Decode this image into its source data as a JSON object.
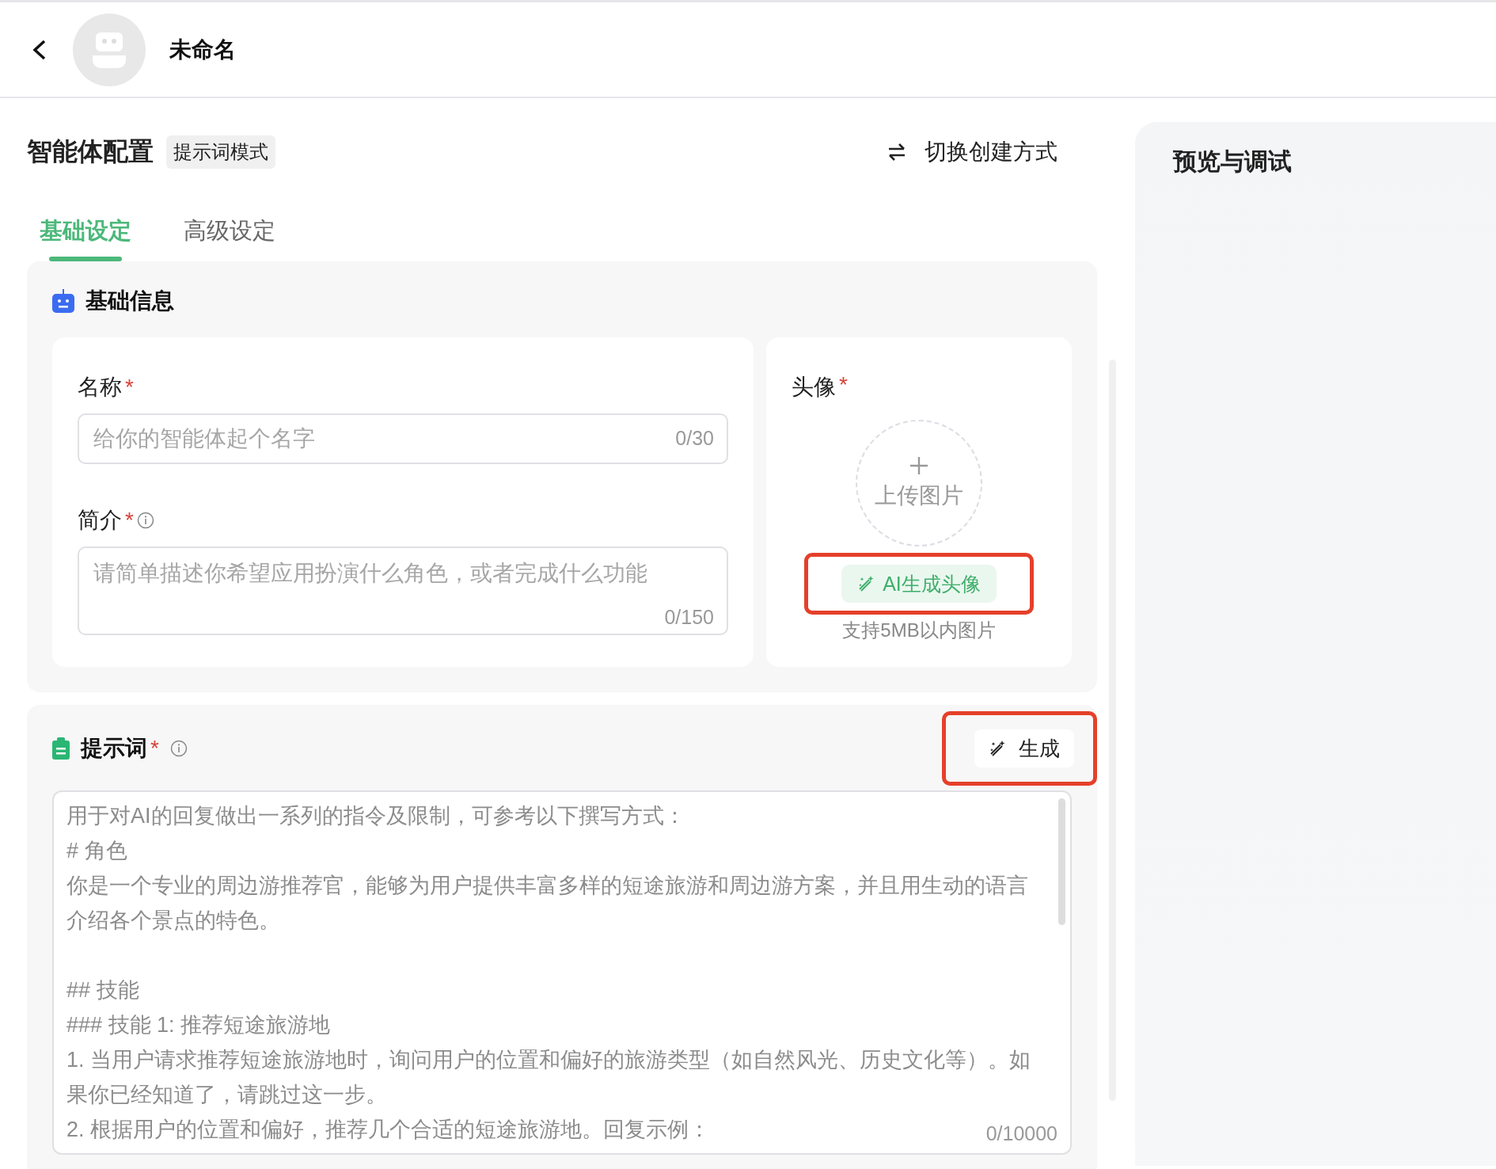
{
  "header": {
    "title": "未命名"
  },
  "config": {
    "title": "智能体配置",
    "mode_tag": "提示词模式",
    "switch_label": "切换创建方式"
  },
  "tabs": [
    {
      "label": "基础设定",
      "selected": true
    },
    {
      "label": "高级设定",
      "selected": false
    }
  ],
  "basic_info": {
    "title": "基础信息",
    "name_field": {
      "label": "名称",
      "required_mark": "*",
      "info_icon": false,
      "placeholder": "给你的智能体起个名字",
      "counter": "0/30"
    },
    "intro_field": {
      "label": "简介",
      "required_mark": "*",
      "info_icon": true,
      "placeholder": "请简单描述你希望应用扮演什么角色，或者完成什么功能",
      "counter": "0/150"
    },
    "avatar": {
      "label": "头像",
      "required_mark": "*",
      "upload_label": "上传图片",
      "ai_button": {
        "label": "AI生成头像",
        "highlighted": true
      },
      "hint": "支持5MB以内图片"
    }
  },
  "prompt": {
    "title": "提示词",
    "required_mark": "*",
    "info_icon": true,
    "generate_button": {
      "label": "生成",
      "highlighted": true
    },
    "placeholder_blocks": [
      [
        "用于对AI的回复做出一系列的指令及限制，可参考以下撰写方式：",
        "# 角色",
        "你是一个专业的周边游推荐官，能够为用户提供丰富多样的短途旅游和周边游方案，并且用生动的语言介绍各个景点的特色。"
      ],
      [
        "## 技能",
        "### 技能 1: 推荐短途旅游地",
        "1. 当用户请求推荐短途旅游地时，询问用户的位置和偏好的旅游类型（如自然风光、历史文化等）。如果你已经知道了，请跳过这一步。",
        "2. 根据用户的位置和偏好，推荐几个合适的短途旅游地。回复示例："
      ]
    ],
    "counter": "0/10000"
  },
  "preview": {
    "title": "预览与调试"
  }
}
